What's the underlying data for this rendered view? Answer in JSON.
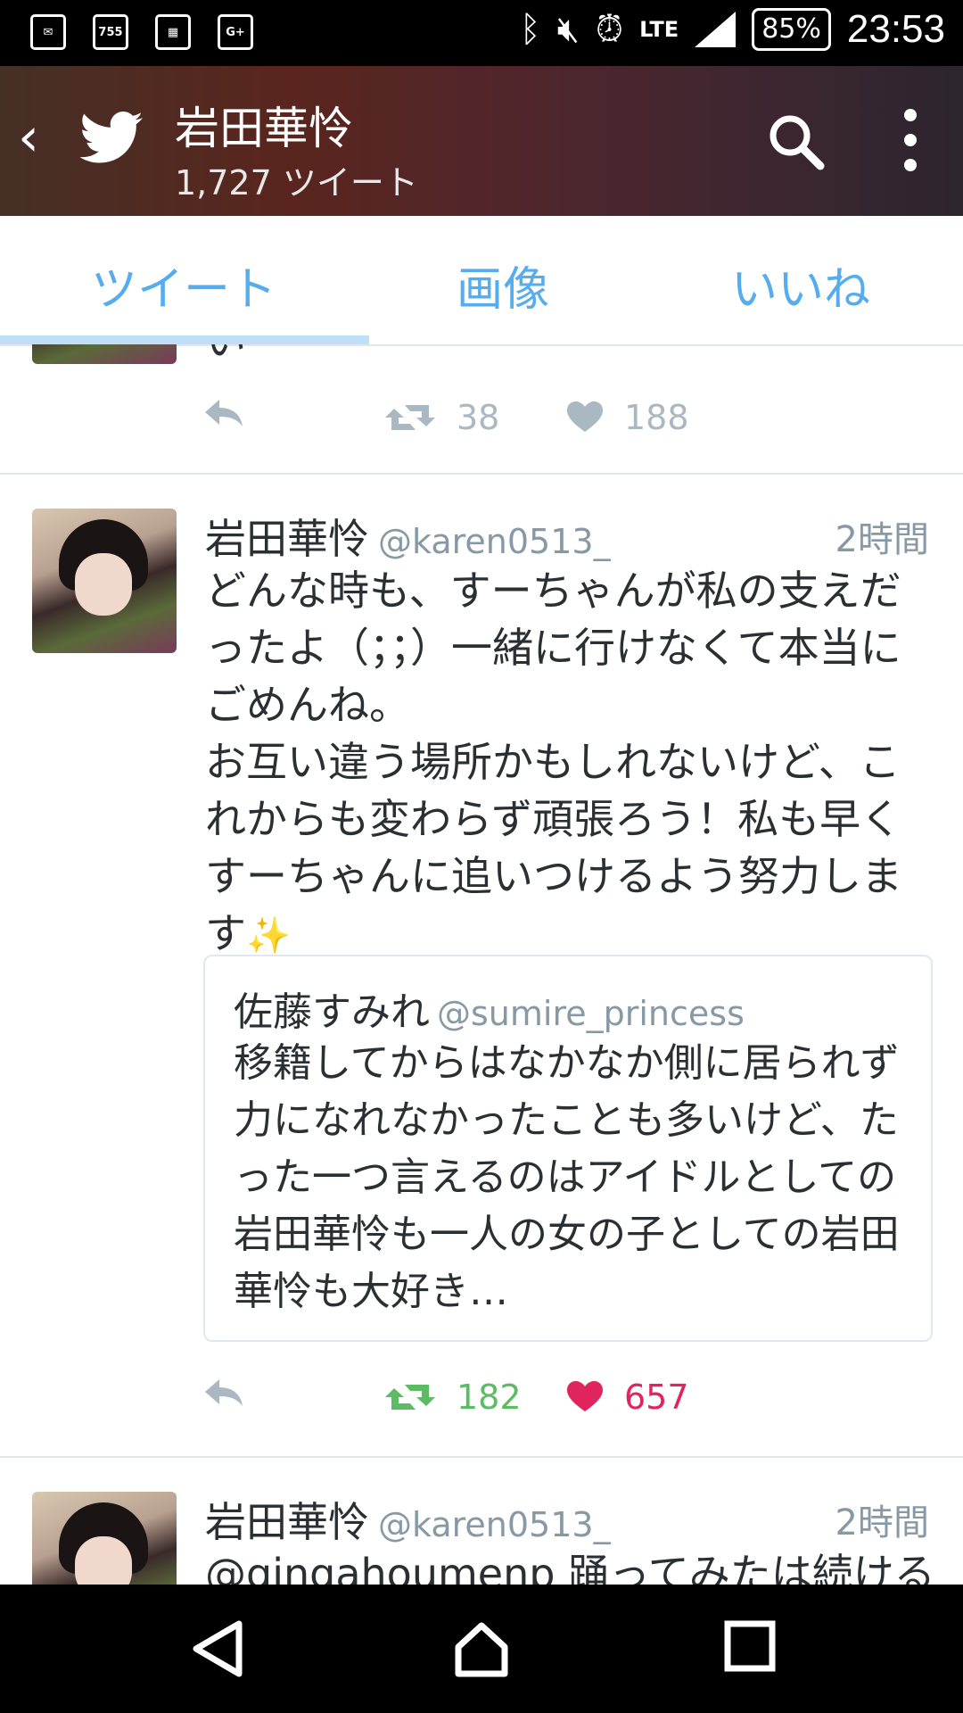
{
  "status_bar": {
    "left_icons": [
      "mail-icon",
      "755-icon",
      "calendar-icon",
      "google-plus-icon"
    ],
    "lte": "LTE",
    "battery": "85%",
    "time": "23:53"
  },
  "header": {
    "title": "岩田華怜",
    "tweet_count": "1,727 ツイート"
  },
  "tabs": [
    {
      "label": "ツイート",
      "active": true
    },
    {
      "label": "画像",
      "active": false
    },
    {
      "label": "いいね",
      "active": false
    }
  ],
  "tweets": [
    {
      "partial_text": "い",
      "retweets": "38",
      "likes": "188"
    },
    {
      "name": "岩田華怜",
      "handle": "@karen0513_",
      "time": "2時間",
      "text": "どんな時も、すーちゃんが私の支えだったよ（；；）一緒に行けなくて本当にごめんね。\nお互い違う場所かもしれないけど、これからも変わらず頑張ろう！私も早くすーちゃんに追いつけるよう努力します",
      "sparkle": "✨",
      "quote": {
        "name": "佐藤すみれ",
        "handle": "@sumire_princess",
        "text": "移籍してからはなかなか側に居られず力になれなかったことも多いけど、たった一つ言えるのはアイドルとしての岩田華怜も一人の女の子としての岩田華怜も大好き…"
      },
      "retweets": "182",
      "likes": "657",
      "retweet_color": "#5dbb63",
      "like_color": "#e0245e"
    },
    {
      "name": "岩田華怜",
      "handle": "@karen0513_",
      "time": "2時間",
      "text": "@gingahoumenp 踊ってみたは続ける"
    }
  ],
  "colors": {
    "accent": "#55acee",
    "muted": "#8899a6",
    "text": "#292f33"
  }
}
